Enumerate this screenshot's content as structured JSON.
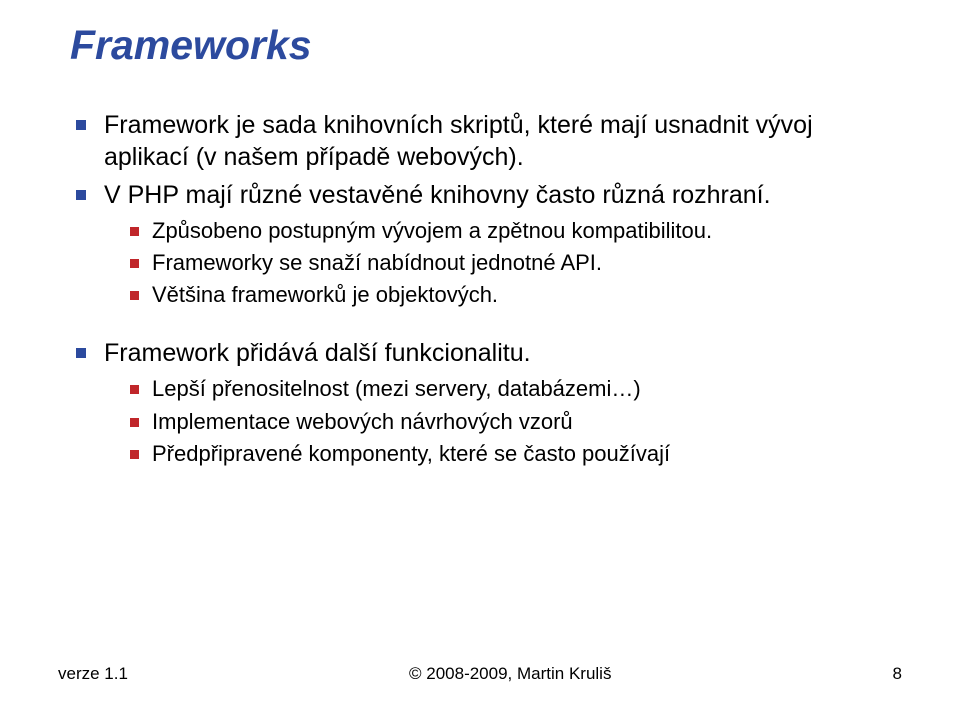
{
  "title": "Frameworks",
  "bullets": {
    "b1": "Framework je sada knihovních skriptů, které mají usnadnit vývoj aplikací (v našem případě webových).",
    "b2": "V PHP mají různé vestavěné knihovny často různá rozhraní.",
    "b2_1": "Způsobeno postupným vývojem a zpětnou kompatibilitou.",
    "b2_2": "Frameworky se snaží nabídnout jednotné API.",
    "b2_3": "Většina frameworků je objektových.",
    "b3": "Framework přidává další funkcionalitu.",
    "b3_1": "Lepší přenositelnost (mezi servery, databázemi…)",
    "b3_2": "Implementace webových návrhových vzorů",
    "b3_3": "Předpřipravené komponenty, které se často používají"
  },
  "footer": {
    "version": "verze 1.1",
    "copyright": "© 2008-2009, Martin Kruliš",
    "page": "8"
  }
}
